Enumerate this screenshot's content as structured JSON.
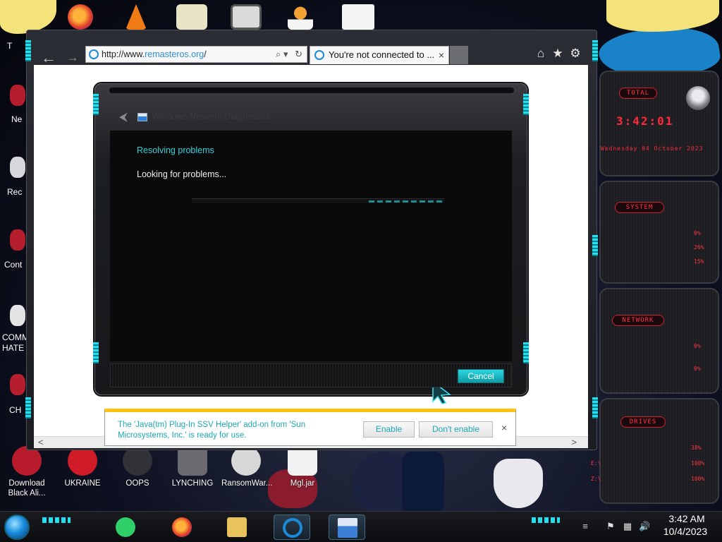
{
  "browser": {
    "url_prefix": "http://www.",
    "url_host": "remasteros.org",
    "url_suffix": "/",
    "tab_title": "You're not connected to ...",
    "tab_close": "×",
    "back_glyph": "←",
    "forward_glyph": "→",
    "home_glyph": "⌂",
    "favorites_glyph": "★",
    "settings_glyph": "⚙",
    "search_glyph": "⌕ ▾",
    "refresh_glyph": "↻",
    "scroll_left": "<",
    "scroll_right": ">"
  },
  "dialog": {
    "title": "Windows Network Diagnostics",
    "heading": "Resolving problems",
    "status": "Looking for problems...",
    "progress": 0.3,
    "cancel_label": "Cancel",
    "back_glyph": "⮜"
  },
  "notification": {
    "message": "The 'Java(tm) Plug-In SSV Helper' add-on from 'Sun Microsystems, Inc.' is ready for use.",
    "enable_label": "Enable",
    "dont_enable_label": "Don't enable",
    "close_glyph": "×"
  },
  "gadget": {
    "cpu_badge": "TOTAL",
    "time": "3:42:01",
    "date": "Wednesday 04 October 2023",
    "system_badge": "SYSTEM",
    "system_values": [
      "0%",
      "26%",
      "15%"
    ],
    "network_badge": "NETWORK",
    "network_values": [
      "0%",
      "0%"
    ],
    "drives_badge": "DRIVES",
    "drives_labels": [
      "",
      "E:\\",
      "Z:\\"
    ],
    "drives_values": [
      "38%",
      "100%",
      "100%"
    ]
  },
  "desktop": {
    "left_labels": [
      "Ne",
      "Rec",
      "Cont",
      "COMM",
      "HATE",
      "CH"
    ],
    "top_label": "T",
    "bottom_icons": [
      {
        "label": "Download Black Ali...",
        "icon": "app-icon",
        "color": "#b81c2c"
      },
      {
        "label": "UKRAINE",
        "icon": "radiation-icon",
        "color": "#d01c28"
      },
      {
        "label": "OOPS",
        "icon": "bomb-icon",
        "color": "#303238"
      },
      {
        "label": "LYNCHING",
        "icon": "flag-icon",
        "color": "#6a6a70"
      },
      {
        "label": "RansomWar...",
        "icon": "skull-icon",
        "color": "#d8d8d8"
      },
      {
        "label": "Mgl.jar",
        "icon": "java-icon",
        "color": "#f2f2f2"
      }
    ]
  },
  "taskbar": {
    "time": "3:42 AM",
    "date": "10/4/2023",
    "pinned": [
      {
        "name": "messages",
        "color": "#2fd06a"
      },
      {
        "name": "firefox",
        "color": "#ff6f1e"
      },
      {
        "name": "file-explorer",
        "color": "#e8c25a"
      },
      {
        "name": "internet-explorer",
        "color": "#1b8ad8"
      },
      {
        "name": "network-diagnostics",
        "color": "#3b7fd6"
      }
    ],
    "tray_glyphs": [
      "⚑",
      "▦",
      "🔊"
    ]
  }
}
